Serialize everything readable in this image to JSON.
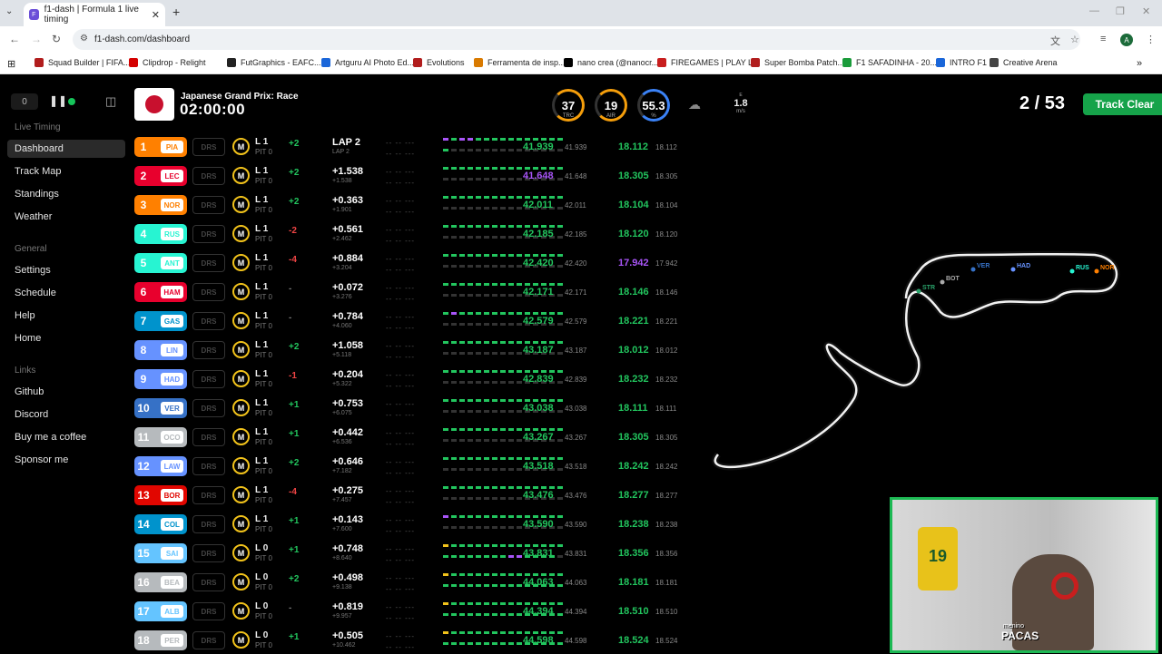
{
  "browser": {
    "tab_title": "f1-dash | Formula 1 live timing",
    "url": "f1-dash.com/dashboard",
    "bookmarks": [
      {
        "label": "Squad Builder | FIFA...",
        "color": "#b11d1d"
      },
      {
        "label": "Clipdrop - Relight",
        "color": "#d40000"
      },
      {
        "label": "FutGraphics - EAFC...",
        "color": "#222222"
      },
      {
        "label": "Artguru AI Photo Ed...",
        "color": "#1a66d9"
      },
      {
        "label": "Evolutions",
        "color": "#b11d1d"
      },
      {
        "label": "Ferramenta de insp...",
        "color": "#d97a00"
      },
      {
        "label": "nano crea (@nanocr...",
        "color": "#000000"
      },
      {
        "label": "FIREGAMES | PLAY L...",
        "color": "#c81e1e"
      },
      {
        "label": "Super Bomba Patch...",
        "color": "#b11d1d"
      },
      {
        "label": "F1 SAFADINHA - 20...",
        "color": "#1a9b3a"
      },
      {
        "label": "INTRO F1",
        "color": "#1a66d9"
      },
      {
        "label": "Creative Arena",
        "color": "#444444"
      }
    ]
  },
  "sidebar": {
    "counter": "0",
    "sections": [
      {
        "title": "Live Timing",
        "items": [
          "Dashboard",
          "Track Map",
          "Standings",
          "Weather"
        ]
      },
      {
        "title": "General",
        "items": [
          "Settings",
          "Schedule",
          "Help",
          "Home"
        ]
      },
      {
        "title": "Links",
        "items": [
          "Github",
          "Discord",
          "Buy me a coffee",
          "Sponsor me"
        ]
      }
    ],
    "active": "Dashboard"
  },
  "header": {
    "race_name": "Japanese Grand Prix: Race",
    "race_time": "02:00:00",
    "weather": [
      {
        "value": "37",
        "label": "TRC",
        "color": "#f59e0b"
      },
      {
        "value": "19",
        "label": "AIR",
        "color": "#f59e0b"
      },
      {
        "value": "55.3",
        "label": "%",
        "color": "#3b82f6"
      }
    ],
    "wind_speed": "1.8",
    "wind_unit": "m/s",
    "wind_dir": "E",
    "laps": "2 / 53",
    "track_status": "Track Clear"
  },
  "drivers": [
    {
      "pos": "1",
      "tla": "PIA",
      "team": "#ff8000",
      "tyre": "M",
      "lap": "L 1",
      "pit": "PIT 0",
      "gain": "+2",
      "gain_color": "#22c55e",
      "gap": "LAP 2",
      "gap2": "LAP 2",
      "last": "41.939",
      "last2": "41.939",
      "last_color": "#22c55e",
      "best_s": "18.112",
      "best_s2": "18.112",
      "best_color": "#22c55e",
      "mini": "pgppgggggggggggg"
    },
    {
      "pos": "2",
      "tla": "LEC",
      "team": "#e8002d",
      "tyre": "M",
      "lap": "L 1",
      "pit": "PIT 0",
      "gain": "+2",
      "gain_color": "#22c55e",
      "gap": "+1.538",
      "gap2": "+1.538",
      "last": "41.648",
      "last2": "41.648",
      "last_color": "#a855f7",
      "best_s": "18.305",
      "best_s2": "18.305",
      "best_color": "#22c55e",
      "mini": "ggggggggggggggg"
    },
    {
      "pos": "3",
      "tla": "NOR",
      "team": "#ff8000",
      "tyre": "M",
      "lap": "L 1",
      "pit": "PIT 0",
      "gain": "+2",
      "gain_color": "#22c55e",
      "gap": "+0.363",
      "gap2": "+1.901",
      "last": "42.011",
      "last2": "42.011",
      "last_color": "#22c55e",
      "best_s": "18.104",
      "best_s2": "18.104",
      "best_color": "#22c55e",
      "mini": "ggggggggggggggg"
    },
    {
      "pos": "4",
      "tla": "RUS",
      "team": "#27f4d2",
      "tyre": "M",
      "lap": "L 1",
      "pit": "PIT 0",
      "gain": "-2",
      "gain_color": "#ef4444",
      "gap": "+0.561",
      "gap2": "+2.462",
      "last": "42.185",
      "last2": "42.185",
      "last_color": "#22c55e",
      "best_s": "18.120",
      "best_s2": "18.120",
      "best_color": "#22c55e",
      "mini": "ggggggggggggggg"
    },
    {
      "pos": "5",
      "tla": "ANT",
      "team": "#27f4d2",
      "tyre": "M",
      "lap": "L 1",
      "pit": "PIT 0",
      "gain": "-4",
      "gain_color": "#ef4444",
      "gap": "+0.884",
      "gap2": "+3.204",
      "last": "42.420",
      "last2": "42.420",
      "last_color": "#22c55e",
      "best_s": "17.942",
      "best_s2": "17.942",
      "best_color": "#a855f7",
      "mini": "ggggggggggggggg"
    },
    {
      "pos": "6",
      "tla": "HAM",
      "team": "#e8002d",
      "tyre": "M",
      "lap": "L 1",
      "pit": "PIT 0",
      "gain": "-",
      "gain_color": "#777777",
      "gap": "+0.072",
      "gap2": "+3.276",
      "last": "42.171",
      "last2": "42.171",
      "last_color": "#22c55e",
      "best_s": "18.146",
      "best_s2": "18.146",
      "best_color": "#22c55e",
      "mini": "ggggggggggggggg"
    },
    {
      "pos": "7",
      "tla": "GAS",
      "team": "#0093cc",
      "tyre": "M",
      "lap": "L 1",
      "pit": "PIT 0",
      "gain": "-",
      "gain_color": "#777777",
      "gap": "+0.784",
      "gap2": "+4.060",
      "last": "42.579",
      "last2": "42.579",
      "last_color": "#22c55e",
      "best_s": "18.221",
      "best_s2": "18.221",
      "best_color": "#22c55e",
      "mini": "gpggggggggggggg"
    },
    {
      "pos": "8",
      "tla": "LIN",
      "team": "#6692ff",
      "tyre": "M",
      "lap": "L 1",
      "pit": "PIT 0",
      "gain": "+2",
      "gain_color": "#22c55e",
      "gap": "+1.058",
      "gap2": "+5.118",
      "last": "43.187",
      "last2": "43.187",
      "last_color": "#22c55e",
      "best_s": "18.012",
      "best_s2": "18.012",
      "best_color": "#22c55e",
      "mini": "ggggggggggggggg"
    },
    {
      "pos": "9",
      "tla": "HAD",
      "team": "#6692ff",
      "tyre": "M",
      "lap": "L 1",
      "pit": "PIT 0",
      "gain": "-1",
      "gain_color": "#ef4444",
      "gap": "+0.204",
      "gap2": "+5.322",
      "last": "42.839",
      "last2": "42.839",
      "last_color": "#22c55e",
      "best_s": "18.232",
      "best_s2": "18.232",
      "best_color": "#22c55e",
      "mini": "ggggggggggggggg"
    },
    {
      "pos": "10",
      "tla": "VER",
      "team": "#3671c6",
      "tyre": "M",
      "lap": "L 1",
      "pit": "PIT 0",
      "gain": "+1",
      "gain_color": "#22c55e",
      "gap": "+0.753",
      "gap2": "+6.075",
      "last": "43.038",
      "last2": "43.038",
      "last_color": "#22c55e",
      "best_s": "18.111",
      "best_s2": "18.111",
      "best_color": "#22c55e",
      "mini": "ggggggggggggggg"
    },
    {
      "pos": "11",
      "tla": "OCO",
      "team": "#b6babd",
      "tyre": "M",
      "lap": "L 1",
      "pit": "PIT 0",
      "gain": "+1",
      "gain_color": "#22c55e",
      "gap": "+0.442",
      "gap2": "+6.536",
      "last": "43.267",
      "last2": "43.267",
      "last_color": "#22c55e",
      "best_s": "18.305",
      "best_s2": "18.305",
      "best_color": "#22c55e",
      "mini": "ggggggggggggggg"
    },
    {
      "pos": "12",
      "tla": "LAW",
      "team": "#6692ff",
      "tyre": "M",
      "lap": "L 1",
      "pit": "PIT 0",
      "gain": "+2",
      "gain_color": "#22c55e",
      "gap": "+0.646",
      "gap2": "+7.182",
      "last": "43.518",
      "last2": "43.518",
      "last_color": "#22c55e",
      "best_s": "18.242",
      "best_s2": "18.242",
      "best_color": "#22c55e",
      "mini": "ggggggggggggggg"
    },
    {
      "pos": "13",
      "tla": "BOR",
      "team": "#e10600",
      "tyre": "M",
      "lap": "L 1",
      "pit": "PIT 0",
      "gain": "-4",
      "gain_color": "#ef4444",
      "gap": "+0.275",
      "gap2": "+7.457",
      "last": "43.476",
      "last2": "43.476",
      "last_color": "#22c55e",
      "best_s": "18.277",
      "best_s2": "18.277",
      "best_color": "#22c55e",
      "mini": "ggggggggggggggg"
    },
    {
      "pos": "14",
      "tla": "COL",
      "team": "#0093cc",
      "tyre": "M",
      "lap": "L 1",
      "pit": "PIT 0",
      "gain": "+1",
      "gain_color": "#22c55e",
      "gap": "+0.143",
      "gap2": "+7.600",
      "last": "43.590",
      "last2": "43.590",
      "last_color": "#22c55e",
      "best_s": "18.238",
      "best_s2": "18.238",
      "best_color": "#22c55e",
      "mini": "pgggggggggggggg"
    },
    {
      "pos": "15",
      "tla": "SAI",
      "team": "#64c4ff",
      "tyre": "M",
      "lap": "L 0",
      "pit": "PIT 0",
      "gain": "+1",
      "gain_color": "#22c55e",
      "gap": "+0.748",
      "gap2": "+8.640",
      "last": "43.831",
      "last2": "43.831",
      "last_color": "#22c55e",
      "best_s": "18.356",
      "best_s2": "18.356",
      "best_color": "#22c55e",
      "mini": "yggggggggggggggggggggggppgggg"
    },
    {
      "pos": "16",
      "tla": "BEA",
      "team": "#b6babd",
      "tyre": "M",
      "lap": "L 0",
      "pit": "PIT 0",
      "gain": "+2",
      "gain_color": "#22c55e",
      "gap": "+0.498",
      "gap2": "+9.138",
      "last": "44.063",
      "last2": "44.063",
      "last_color": "#22c55e",
      "best_s": "18.181",
      "best_s2": "18.181",
      "best_color": "#22c55e",
      "mini": "yggggggggggggggggggggggggggggg"
    },
    {
      "pos": "17",
      "tla": "ALB",
      "team": "#64c4ff",
      "tyre": "M",
      "lap": "L 0",
      "pit": "PIT 0",
      "gain": "-",
      "gain_color": "#777777",
      "gap": "+0.819",
      "gap2": "+9.957",
      "last": "44.394",
      "last2": "44.394",
      "last_color": "#22c55e",
      "best_s": "18.510",
      "best_s2": "18.510",
      "best_color": "#22c55e",
      "mini": "yggggggggggggggggggggggggggggg"
    },
    {
      "pos": "18",
      "tla": "PER",
      "team": "#b6babd",
      "tyre": "M",
      "lap": "L 0",
      "pit": "PIT 0",
      "gain": "+1",
      "gain_color": "#22c55e",
      "gap": "+0.505",
      "gap2": "+10.462",
      "last": "44.598",
      "last2": "44.598",
      "last_color": "#22c55e",
      "best_s": "18.524",
      "best_s2": "18.524",
      "best_color": "#22c55e",
      "mini": "yggggggggggggggggggggggggggggg"
    }
  ],
  "track_map": {
    "car_labels": [
      {
        "tla": "STR",
        "color": "#2aa36b"
      },
      {
        "tla": "BOT",
        "color": "#aaaaaa"
      },
      {
        "tla": "VER",
        "color": "#3671c6"
      },
      {
        "tla": "HAD",
        "color": "#6692ff"
      },
      {
        "tla": "RUS",
        "color": "#27f4d2"
      },
      {
        "tla": "NOR",
        "color": "#ff8000"
      }
    ]
  },
  "webcam": {
    "shirt_number": "19",
    "logo_top": "menino",
    "logo": "PACAS"
  }
}
